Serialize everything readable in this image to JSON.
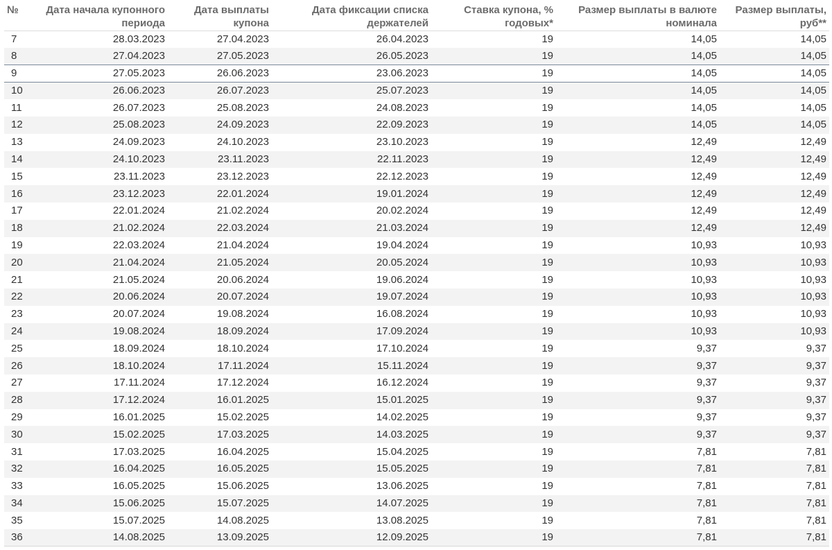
{
  "table": {
    "headers": [
      "№",
      "Дата начала купонного периода",
      "Дата выплаты купона",
      "Дата фиксации списка держателей",
      "Ставка купона, % годовых*",
      "Размер выплаты в валюте номинала",
      "Размер выплаты, руб**"
    ],
    "rows": [
      [
        "7",
        "28.03.2023",
        "27.04.2023",
        "26.04.2023",
        "19",
        "14,05",
        "14,05"
      ],
      [
        "8",
        "27.04.2023",
        "27.05.2023",
        "26.05.2023",
        "19",
        "14,05",
        "14,05"
      ],
      [
        "9",
        "27.05.2023",
        "26.06.2023",
        "23.06.2023",
        "19",
        "14,05",
        "14,05"
      ],
      [
        "10",
        "26.06.2023",
        "26.07.2023",
        "25.07.2023",
        "19",
        "14,05",
        "14,05"
      ],
      [
        "11",
        "26.07.2023",
        "25.08.2023",
        "24.08.2023",
        "19",
        "14,05",
        "14,05"
      ],
      [
        "12",
        "25.08.2023",
        "24.09.2023",
        "22.09.2023",
        "19",
        "14,05",
        "14,05"
      ],
      [
        "13",
        "24.09.2023",
        "24.10.2023",
        "23.10.2023",
        "19",
        "12,49",
        "12,49"
      ],
      [
        "14",
        "24.10.2023",
        "23.11.2023",
        "22.11.2023",
        "19",
        "12,49",
        "12,49"
      ],
      [
        "15",
        "23.11.2023",
        "23.12.2023",
        "22.12.2023",
        "19",
        "12,49",
        "12,49"
      ],
      [
        "16",
        "23.12.2023",
        "22.01.2024",
        "19.01.2024",
        "19",
        "12,49",
        "12,49"
      ],
      [
        "17",
        "22.01.2024",
        "21.02.2024",
        "20.02.2024",
        "19",
        "12,49",
        "12,49"
      ],
      [
        "18",
        "21.02.2024",
        "22.03.2024",
        "21.03.2024",
        "19",
        "12,49",
        "12,49"
      ],
      [
        "19",
        "22.03.2024",
        "21.04.2024",
        "19.04.2024",
        "19",
        "10,93",
        "10,93"
      ],
      [
        "20",
        "21.04.2024",
        "21.05.2024",
        "20.05.2024",
        "19",
        "10,93",
        "10,93"
      ],
      [
        "21",
        "21.05.2024",
        "20.06.2024",
        "19.06.2024",
        "19",
        "10,93",
        "10,93"
      ],
      [
        "22",
        "20.06.2024",
        "20.07.2024",
        "19.07.2024",
        "19",
        "10,93",
        "10,93"
      ],
      [
        "23",
        "20.07.2024",
        "19.08.2024",
        "16.08.2024",
        "19",
        "10,93",
        "10,93"
      ],
      [
        "24",
        "19.08.2024",
        "18.09.2024",
        "17.09.2024",
        "19",
        "10,93",
        "10,93"
      ],
      [
        "25",
        "18.09.2024",
        "18.10.2024",
        "17.10.2024",
        "19",
        "9,37",
        "9,37"
      ],
      [
        "26",
        "18.10.2024",
        "17.11.2024",
        "15.11.2024",
        "19",
        "9,37",
        "9,37"
      ],
      [
        "27",
        "17.11.2024",
        "17.12.2024",
        "16.12.2024",
        "19",
        "9,37",
        "9,37"
      ],
      [
        "28",
        "17.12.2024",
        "16.01.2025",
        "15.01.2025",
        "19",
        "9,37",
        "9,37"
      ],
      [
        "29",
        "16.01.2025",
        "15.02.2025",
        "14.02.2025",
        "19",
        "9,37",
        "9,37"
      ],
      [
        "30",
        "15.02.2025",
        "17.03.2025",
        "14.03.2025",
        "19",
        "9,37",
        "9,37"
      ],
      [
        "31",
        "17.03.2025",
        "16.04.2025",
        "15.04.2025",
        "19",
        "7,81",
        "7,81"
      ],
      [
        "32",
        "16.04.2025",
        "16.05.2025",
        "15.05.2025",
        "19",
        "7,81",
        "7,81"
      ],
      [
        "33",
        "16.05.2025",
        "15.06.2025",
        "13.06.2025",
        "19",
        "7,81",
        "7,81"
      ],
      [
        "34",
        "15.06.2025",
        "15.07.2025",
        "14.07.2025",
        "19",
        "7,81",
        "7,81"
      ],
      [
        "35",
        "15.07.2025",
        "14.08.2025",
        "13.08.2025",
        "19",
        "7,81",
        "7,81"
      ],
      [
        "36",
        "14.08.2025",
        "13.09.2025",
        "12.09.2025",
        "19",
        "7,81",
        "7,81"
      ]
    ],
    "selected_row": "9"
  },
  "colors": {
    "header_text": "#6b6b6b",
    "body_text": "#333333",
    "stripe": "#f3f3f3",
    "selected_border": "#7a8a9a"
  }
}
